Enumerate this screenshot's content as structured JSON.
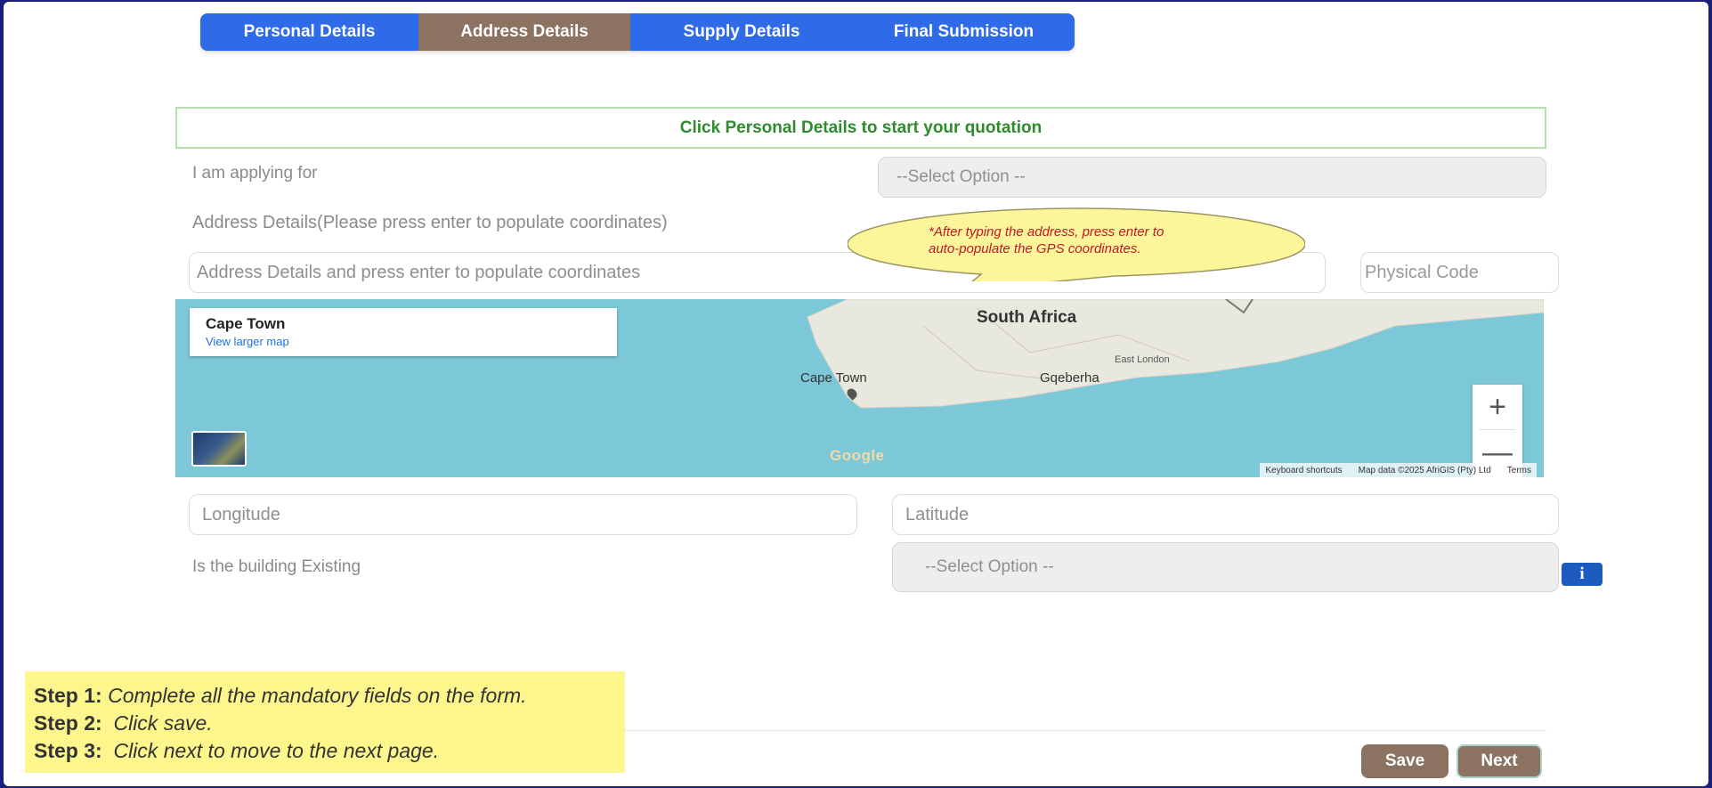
{
  "tabs": [
    {
      "label": "Personal Details"
    },
    {
      "label": "Address Details"
    },
    {
      "label": "Supply Details"
    },
    {
      "label": "Final Submission"
    }
  ],
  "active_tab": "Address Details",
  "colors": {
    "tab_blue": "#2f6ae8",
    "tab_active": "#8b7261",
    "banner_text": "#2e8b2e",
    "callout_text": "#c0182a",
    "steps_bg": "#fdf68c",
    "map_water": "#7cc8d8"
  },
  "banner": {
    "text": "Click Personal Details to start your quotation"
  },
  "form": {
    "applying_label": "I am applying for",
    "applying_select": "--Select Option --",
    "address_label": "Address Details(Please press enter to populate coordinates)",
    "address_placeholder": "Address Details and press enter to populate coordinates",
    "physical_code_placeholder": "Physical Code",
    "longitude_placeholder": "Longitude",
    "latitude_placeholder": "Latitude",
    "building_label": "Is the building Existing",
    "building_select": "--Select Option --"
  },
  "callout": {
    "line1": "*After typing the address, press enter to",
    "line2": "auto-populate the GPS coordinates."
  },
  "map": {
    "card_title": "Cape Town",
    "card_link": "View larger map",
    "labels": {
      "country": "South Africa",
      "city1": "Cape Town",
      "city2": "Gqeberha",
      "city3": "East London"
    },
    "zoom_in": "+",
    "zoom_out": "—",
    "google": "Google",
    "attribution": {
      "shortcuts": "Keyboard shortcuts",
      "data": "Map data ©2025 AfriGIS (Pty) Ltd",
      "terms": "Terms"
    }
  },
  "info_icon": "i",
  "steps": [
    {
      "label": "Step 1:",
      "text": "Complete all the mandatory fields on the form."
    },
    {
      "label": "Step 2:",
      "text": "Click save."
    },
    {
      "label": "Step 3:",
      "text": "Click next to move to the next page."
    }
  ],
  "buttons": {
    "save": "Save",
    "next": "Next"
  }
}
